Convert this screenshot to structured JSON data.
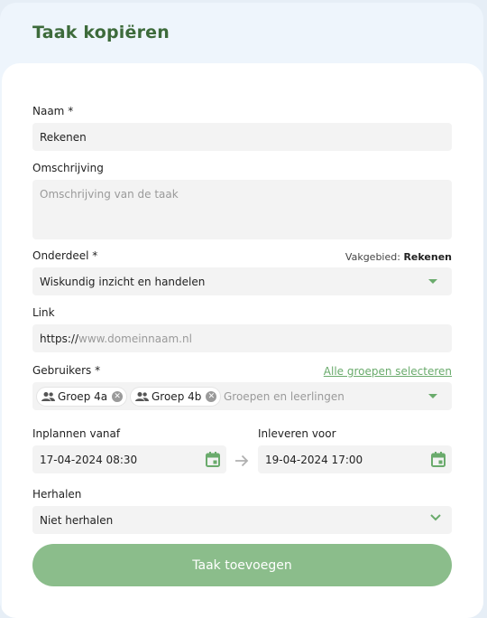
{
  "dialog": {
    "title": "Taak kopiëren"
  },
  "form": {
    "name": {
      "label": "Naam *",
      "value": "Rekenen"
    },
    "description": {
      "label": "Omschrijving",
      "placeholder": "Omschrijving van de taak"
    },
    "part": {
      "label": "Onderdeel *",
      "subject_label": "Vakgebied:",
      "subject_value": "Rekenen",
      "value": "Wiskundig inzicht en handelen"
    },
    "link": {
      "label": "Link",
      "prefix": "https://",
      "placeholder": "www.domeinnaam.nl"
    },
    "users": {
      "label": "Gebruikers *",
      "select_all": "Alle groepen selecteren",
      "chips": [
        "Groep 4a",
        "Groep 4b"
      ],
      "placeholder": "Groepen en leerlingen"
    },
    "start": {
      "label": "Inplannen vanaf",
      "value": "17-04-2024 08:30"
    },
    "due": {
      "label": "Inleveren voor",
      "value": "19-04-2024 17:00"
    },
    "repeat": {
      "label": "Herhalen",
      "value": "Niet herhalen"
    },
    "submit_label": "Taak toevoegen"
  },
  "colors": {
    "accent": "#6aab6c",
    "title": "#3d6b3b",
    "button": "#8bbd8b",
    "field": "#f3f3f3"
  },
  "icons": [
    "people-icon",
    "chip-remove-icon",
    "dropdown-triangle-icon",
    "calendar-icon",
    "arrow-right-icon",
    "chevron-down-icon"
  ]
}
